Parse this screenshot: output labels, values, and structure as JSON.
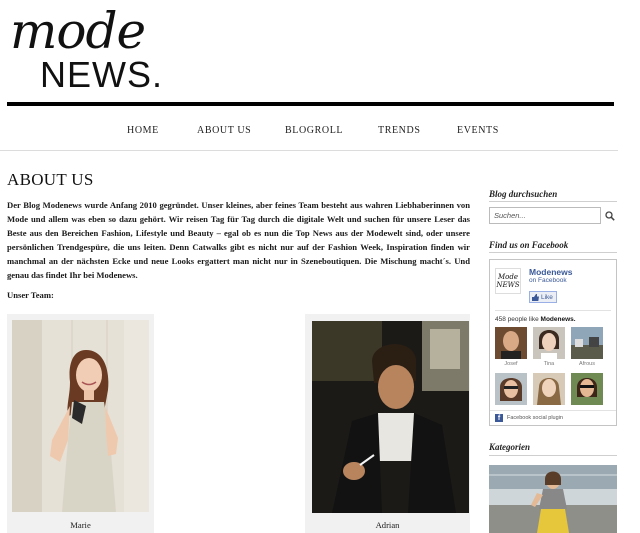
{
  "logo": {
    "script": "mode",
    "news": "NEWS",
    "dot": "."
  },
  "nav": {
    "items": [
      {
        "label": "HOME"
      },
      {
        "label": "ABOUT US"
      },
      {
        "label": "BLOGROLL"
      },
      {
        "label": "TRENDS"
      },
      {
        "label": "EVENTS"
      }
    ]
  },
  "main": {
    "title": "ABOUT US",
    "intro": "Der Blog Modenews wurde Anfang 2010 gegründet. Unser kleines, aber feines Team besteht aus wahren Liebhaberinnen von Mode und allem was eben so dazu gehört. Wir reisen Tag für Tag durch die digitale Welt und suchen für unsere Leser das Beste aus den Bereichen Fashion, Lifestyle und Beauty – egal ob es nun die Top News aus der Modewelt sind, oder unsere persönlichen Trendgespüre, die uns leiten. Denn Catwalks gibt es nicht nur auf der Fashion Week, Inspiration finden wir manchmal an der nächsten Ecke und neue Looks ergattert man nicht nur in Szeneboutiquen. Die Mischung macht´s. Und genau das findet Ihr bei Modenews.",
    "team_label": "Unser Team:",
    "team": [
      {
        "name": "Marie"
      },
      {
        "name": "Adrian"
      }
    ]
  },
  "sidebar": {
    "search_title": "Blog durchsuchen",
    "search_placeholder": "Suchen...",
    "facebook_title": "Find us on Facebook",
    "facebook": {
      "logo_text": "Mode NEWS",
      "page_name": "Modenews",
      "on_text": "on",
      "platform": "Facebook",
      "like_label": "Like",
      "count_text": "458 people like",
      "count_page": "Modenews.",
      "faces": [
        {
          "name": "Josef"
        },
        {
          "name": "Tina"
        },
        {
          "name": "Afrous"
        },
        {
          "name": ""
        },
        {
          "name": ""
        },
        {
          "name": ""
        }
      ],
      "plugin_label": "Facebook social plugin"
    },
    "categories_title": "Kategorien"
  },
  "colors": {
    "facebook_blue": "#3b5998",
    "rule": "#000000",
    "text": "#111111"
  }
}
